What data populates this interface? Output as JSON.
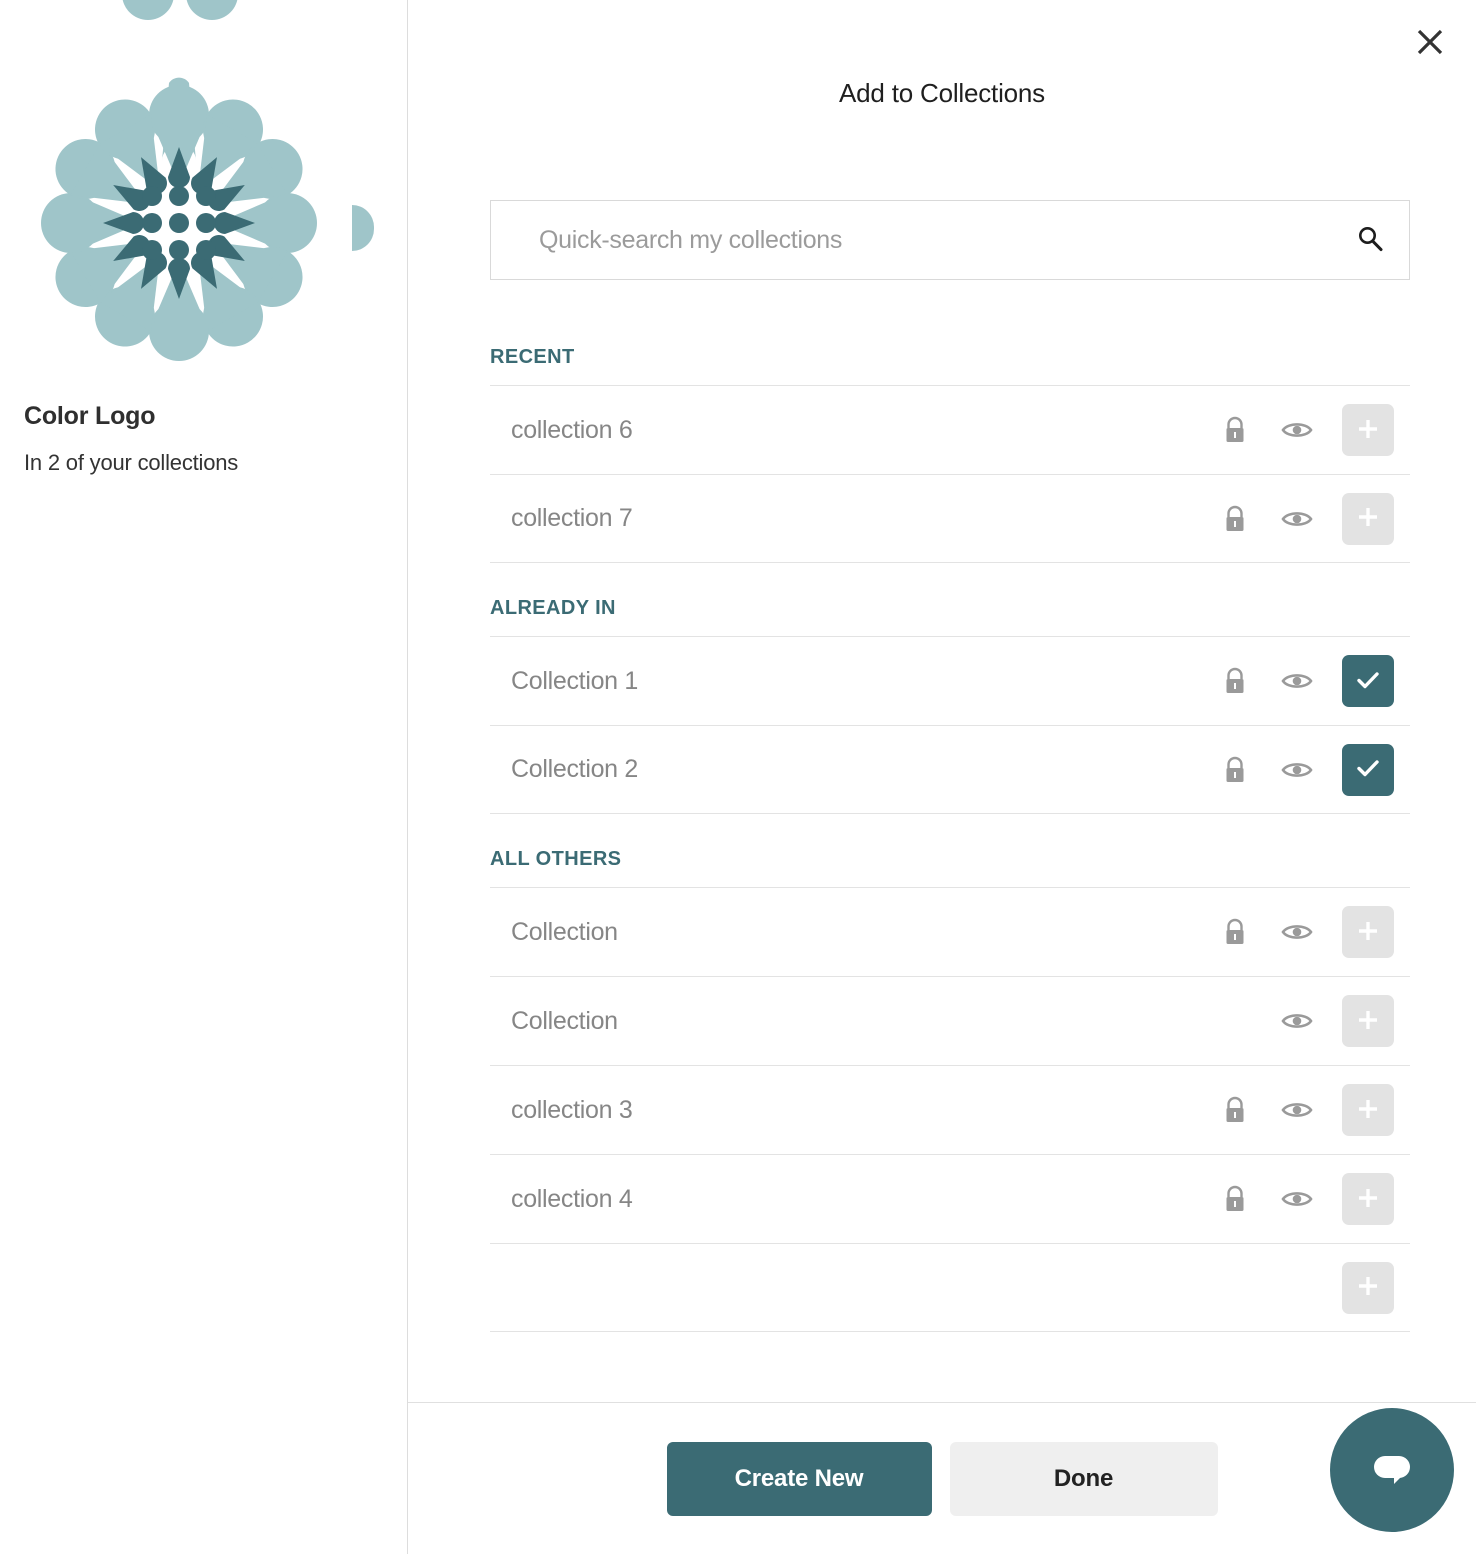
{
  "item": {
    "title": "Color Logo",
    "subtitle": "In 2 of your collections",
    "logo_colors": {
      "outer_petal": "#9fc5c9",
      "inner_petal": "#3b6b74",
      "center_dot": "#3b6b74"
    }
  },
  "dialog": {
    "title": "Add to Collections",
    "close_icon": "close-icon"
  },
  "search": {
    "value": "",
    "placeholder": "Quick-search my collections",
    "icon": "search-icon"
  },
  "sections": [
    {
      "header": "RECENT",
      "rows": [
        {
          "name": "collection 6",
          "lock": true,
          "eye": true,
          "state": "add",
          "action_icon": "plus-icon"
        },
        {
          "name": "collection 7",
          "lock": true,
          "eye": true,
          "state": "add",
          "action_icon": "plus-icon"
        }
      ]
    },
    {
      "header": "ALREADY IN",
      "rows": [
        {
          "name": "Collection 1",
          "lock": true,
          "eye": true,
          "state": "checked",
          "action_icon": "check-icon"
        },
        {
          "name": "Collection 2",
          "lock": true,
          "eye": true,
          "state": "checked",
          "action_icon": "check-icon"
        }
      ]
    },
    {
      "header": "ALL OTHERS",
      "rows": [
        {
          "name": "Collection",
          "lock": true,
          "eye": true,
          "state": "add",
          "action_icon": "plus-icon"
        },
        {
          "name": "Collection",
          "lock": false,
          "eye": true,
          "state": "add",
          "action_icon": "plus-icon"
        },
        {
          "name": "collection 3",
          "lock": true,
          "eye": true,
          "state": "add",
          "action_icon": "plus-icon"
        },
        {
          "name": "collection 4",
          "lock": true,
          "eye": true,
          "state": "add",
          "action_icon": "plus-icon"
        },
        {
          "name": "",
          "lock": false,
          "eye": false,
          "state": "add",
          "action_icon": "plus-icon"
        }
      ]
    }
  ],
  "footer": {
    "create_new_label": "Create New",
    "done_label": "Done"
  },
  "chat": {
    "icon": "chat-bubble-icon"
  },
  "colors": {
    "accent_teal": "#3b6b74",
    "light_teal": "#9fc5c9",
    "muted_text": "#868686",
    "button_grey": "#e3e3e3"
  }
}
